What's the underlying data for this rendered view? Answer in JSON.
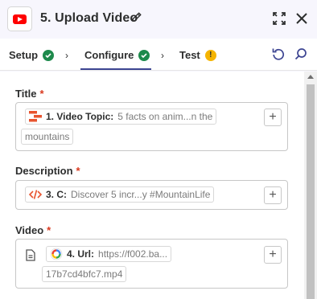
{
  "header": {
    "title": "5. Upload Video",
    "app_icon": "youtube-icon",
    "icons": [
      "pencil-icon",
      "expand-icon",
      "close-icon"
    ]
  },
  "tabs": [
    {
      "label": "Setup",
      "status": "complete"
    },
    {
      "label": "Configure",
      "status": "complete",
      "active": true
    },
    {
      "label": "Test",
      "status": "warning"
    }
  ],
  "tab_actions": [
    "undo-icon",
    "search-icon"
  ],
  "fields": [
    {
      "label": "Title",
      "required_mark": "*",
      "pill_icon": "formatter-icon",
      "pill_key": "1. Video Topic:",
      "pill_value": "5 facts on anim...n the",
      "continuation": "mountains"
    },
    {
      "label": "Description",
      "required_mark": "*",
      "pill_icon": "code-icon",
      "pill_key": "3. C:",
      "pill_value": "Discover 5 incr...y #MountainLife"
    },
    {
      "label": "Video",
      "required_mark": "*",
      "file_icon": "file-icon",
      "pill_icon": "ai-app-icon",
      "pill_key": "4. Url:",
      "pill_value": "https://f002.ba...",
      "continuation": "17b7cd4bfc7.mp4"
    }
  ],
  "colors": {
    "accent": "#3d4592",
    "success": "#1e8a4c",
    "warning": "#f5b400",
    "required": "#d9381e",
    "brand_youtube": "#ff0000"
  }
}
